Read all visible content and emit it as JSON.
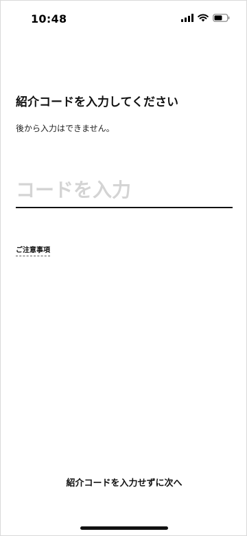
{
  "status_bar": {
    "time": "10:48",
    "icons": [
      "signal-icon",
      "wifi-icon",
      "battery-icon"
    ]
  },
  "referral": {
    "heading": "紹介コードを入力してください",
    "subtext": "後から入力はできません。",
    "input_value": "",
    "input_placeholder": "コードを入力",
    "notes_link": "ご注意事項",
    "skip_button": "紹介コードを入力せずに次へ"
  },
  "colors": {
    "background": "#ffffff",
    "text": "#111111",
    "placeholder": "#d4d4d4",
    "underline": "#111111"
  }
}
